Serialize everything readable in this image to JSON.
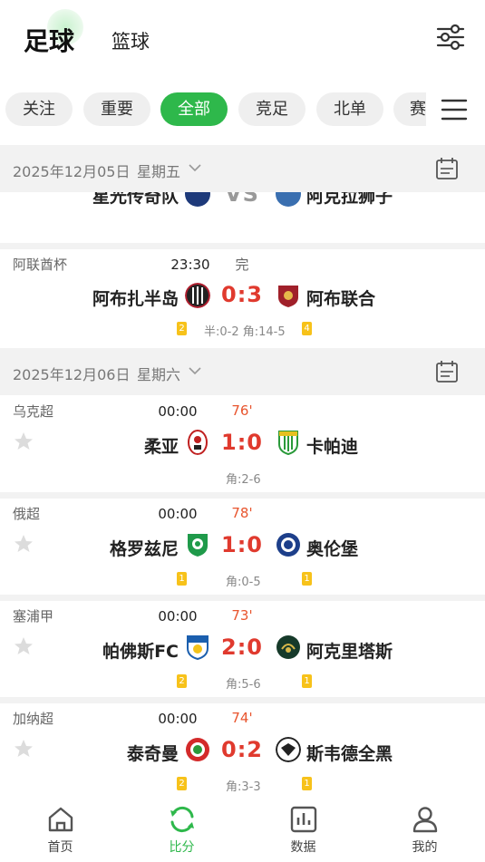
{
  "header": {
    "sport_active": "足球",
    "sport_other": "篮球"
  },
  "tabs": [
    "关注",
    "重要",
    "全部",
    "竞足",
    "北单",
    "赛"
  ],
  "active_tab": "全部",
  "dates": [
    {
      "date": "2025年12月05日",
      "weekday": "星期五"
    },
    {
      "date": "2025年12月06日",
      "weekday": "星期六"
    }
  ],
  "partial_match": {
    "home": "星光传奇队",
    "score": "VS",
    "away": "阿克拉狮子"
  },
  "matches": [
    {
      "league": "阿联酋杯",
      "time": "23:30",
      "status": "完",
      "home": "阿布扎半岛",
      "score": "0:3",
      "away": "阿布联合",
      "home_cards": "2",
      "away_cards": "4",
      "extra": "半:0-2 角:14-5"
    },
    {
      "league": "乌克超",
      "time": "00:00",
      "status": "76'",
      "home": "柔亚",
      "score": "1:0",
      "away": "卡帕迪",
      "home_cards": "",
      "away_cards": "",
      "extra": "角:2-6"
    },
    {
      "league": "俄超",
      "time": "00:00",
      "status": "78'",
      "home": "格罗兹尼",
      "score": "1:0",
      "away": "奥伦堡",
      "home_cards": "1",
      "away_cards": "1",
      "extra": "角:0-5"
    },
    {
      "league": "塞浦甲",
      "time": "00:00",
      "status": "73'",
      "home": "帕佛斯FC",
      "score": "2:0",
      "away": "阿克里塔斯",
      "home_cards": "2",
      "away_cards": "1",
      "extra": "角:5-6"
    },
    {
      "league": "加纳超",
      "time": "00:00",
      "status": "74'",
      "home": "泰奇曼",
      "score": "0:2",
      "away": "斯韦德全黑",
      "home_cards": "2",
      "away_cards": "1",
      "extra": "角:3-3"
    }
  ],
  "bottom_nav": [
    {
      "label": "首页",
      "icon": "home-icon"
    },
    {
      "label": "比分",
      "icon": "refresh-score-icon"
    },
    {
      "label": "数据",
      "icon": "bar-chart-icon"
    },
    {
      "label": "我的",
      "icon": "user-icon"
    }
  ],
  "colors": {
    "accent": "#2eb84b",
    "score": "#e03a2e",
    "live": "#e8552e",
    "yellow_card": "#f7c21a"
  }
}
